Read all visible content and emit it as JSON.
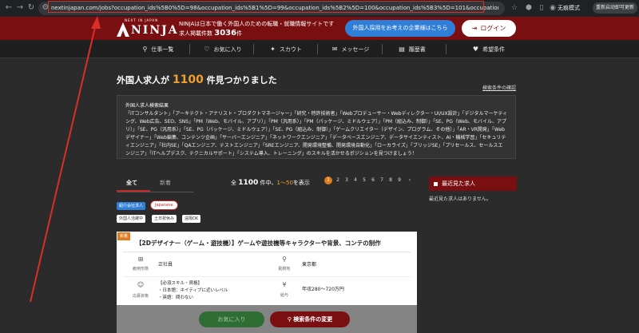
{
  "browser": {
    "url": "nextinjapan.com/jobs?occupation_ids%5B0%5D=98&occupation_ids%5B1%5D=99&occupation_ids%5B2%5D=100&occupation_ids%5B3%5D=101&occupation_ids%5B4%5D=102&occupati",
    "incognito_label": "无痕模式",
    "update_label": "重新启动即可更新",
    "annotation_color": "#d93025"
  },
  "header": {
    "logo_sub": "NEXT IN JAPAN",
    "logo_text": "NINJA",
    "tagline": "NINJAは日本で働く外国人のための転職・就職情報サイトです",
    "job_count_prefix": "求人掲載件数",
    "job_count": "3036",
    "job_count_suffix": "件",
    "employer_button": "外国人採用をお考えの企業様はこちら",
    "login_button": "ログイン",
    "brand_color": "#7a0f12",
    "accent_blue": "#2f7ed8"
  },
  "menu": [
    {
      "label": "仕事一覧",
      "icon": "search-icon"
    },
    {
      "label": "お気に入り",
      "icon": "heart-icon"
    },
    {
      "label": "スカウト",
      "icon": "scout-icon"
    },
    {
      "label": "メッセージ",
      "icon": "message-icon"
    },
    {
      "label": "履歴書",
      "icon": "resume-icon"
    },
    {
      "label": "希望条件",
      "icon": "heart-icon"
    }
  ],
  "results": {
    "title_prefix": "外国人求人が",
    "count": "1100",
    "title_suffix": "件見つかりました",
    "condition_link": "検索条件の確認",
    "criteria_heading": "外国人求人検索結果",
    "criteria_text": "「ITコンサルタント」「アーキテクト・アナリスト・プロダクトマネージャー」「研究・特許技術者」「Webプロデューサー・Webディレクター・UI/UX設計」「デジタルマーケティング、Web広告、SEO、SNS」「PM（Web、モバイル、アプリ）」「PM（汎用系）」「PM（パッケージ、ミドルウェア）」「PM（組込み、制御）」「SE、PG（Web、モバイル、アプリ）」「SE、PG（汎用系）」「SE、PG（パッケージ、ミドルウェア）」「SE、PG（組込み、制御）」「ゲームクリエイター（デザイン、プログラム、その他）」「AR・VR開発」「Webデザイナー」「Web編集、コンテンツ企画」「サーバーエンジニア」「ネットワークエンジニア」「データベースエンジニア、データサイエンティスト、AI・機械学習」「セキュリティエンジニア」「社内SE」「QAエンジニア、テストエンジニア」「SREエンジニア、開発環境整備、開発環境自動化」「ローカライズ」「ブリッジSE」「プリセールス、セールスエンジニア」「ITヘルプデスク、テクニカルサポート」「システム導入、トレーニング」のスキルを活かせるポジションを見つけましょう！"
  },
  "tabs": {
    "all": "全て",
    "new": "新着"
  },
  "summary": {
    "prefix": "全",
    "total": "1100",
    "mid": "件中、",
    "range": "1〜50",
    "suffix": "を表示"
  },
  "pagination": [
    "1",
    "2",
    "3",
    "4",
    "5",
    "6",
    "7",
    "8",
    "9",
    "›"
  ],
  "recent": {
    "heading": "最近見た求人",
    "empty": "最近見た求人はありません。"
  },
  "tags": {
    "intro": "紹介会社求人",
    "japanese": "Japanese",
    "active": "外国人活躍中",
    "weekend": "土日祝休み",
    "ok": "遠隔OK"
  },
  "job": {
    "badge": "新着",
    "title": "【2Dデザイナー（ゲーム・遊技機）】ゲームや遊技機等キャラクターや背景、コンテの制作",
    "employment_label": "雇用形態",
    "employment_value": "正社員",
    "location_label": "勤務地",
    "location_value": "東京都",
    "qualification_label": "応募資格",
    "qualification_lines": [
      "【必須スキル・資格】",
      "・日本語：ネイティブに近いレベル",
      "・英語：問わない"
    ],
    "salary_label": "給与",
    "salary_value": "年収280〜720万円"
  },
  "footer_actions": {
    "favorite": "お気に入り",
    "change_search": "検索条件の変更"
  }
}
